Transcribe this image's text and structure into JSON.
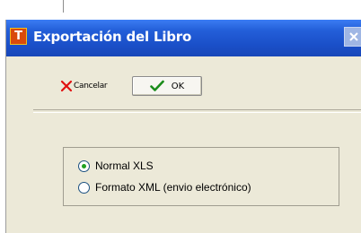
{
  "dialog": {
    "title": "Exportación del Libro",
    "app_icon_letter": "T",
    "title_gradient": [
      "#3b7cf3",
      "#1847b8"
    ],
    "background": "#ece9d8"
  },
  "toolbar": {
    "cancel_label": "Cancelar",
    "cancel_icon": "red-x-icon",
    "cancel_icon_color": "#e01010",
    "ok_label": "OK",
    "ok_icon": "green-check-icon",
    "ok_icon_color": "#1a8c1a"
  },
  "export_options": {
    "selected": "Normal XLS",
    "items": [
      {
        "label": "Normal XLS",
        "checked": true
      },
      {
        "label": "Formato XML (envio electrónico)",
        "checked": false
      }
    ]
  }
}
